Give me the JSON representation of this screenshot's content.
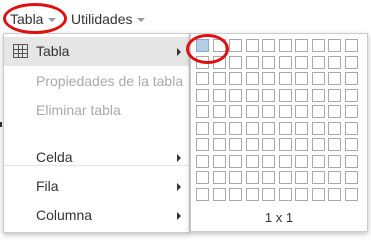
{
  "menubar": {
    "items": [
      {
        "label": "Tabla"
      },
      {
        "label": "Utilidades"
      }
    ]
  },
  "table_menu": {
    "items": [
      {
        "label": "Tabla",
        "icon": "table-icon",
        "submenu": true,
        "state": "active"
      },
      {
        "label": "Propiedades de la tabla",
        "state": "disabled"
      },
      {
        "label": "Eliminar tabla",
        "state": "disabled"
      },
      {
        "label": "Celda",
        "submenu": true,
        "state": "enabled"
      },
      {
        "label": "Fila",
        "submenu": true,
        "state": "enabled"
      },
      {
        "label": "Columna",
        "submenu": true,
        "state": "enabled"
      }
    ]
  },
  "grid_picker": {
    "rows": 10,
    "cols": 10,
    "selected_rows": 1,
    "selected_cols": 1,
    "caption": "1 x 1"
  },
  "colors": {
    "annotation": "#e01010",
    "selected_cell": "#b6cde8",
    "active_item": "#e6e6e6"
  }
}
